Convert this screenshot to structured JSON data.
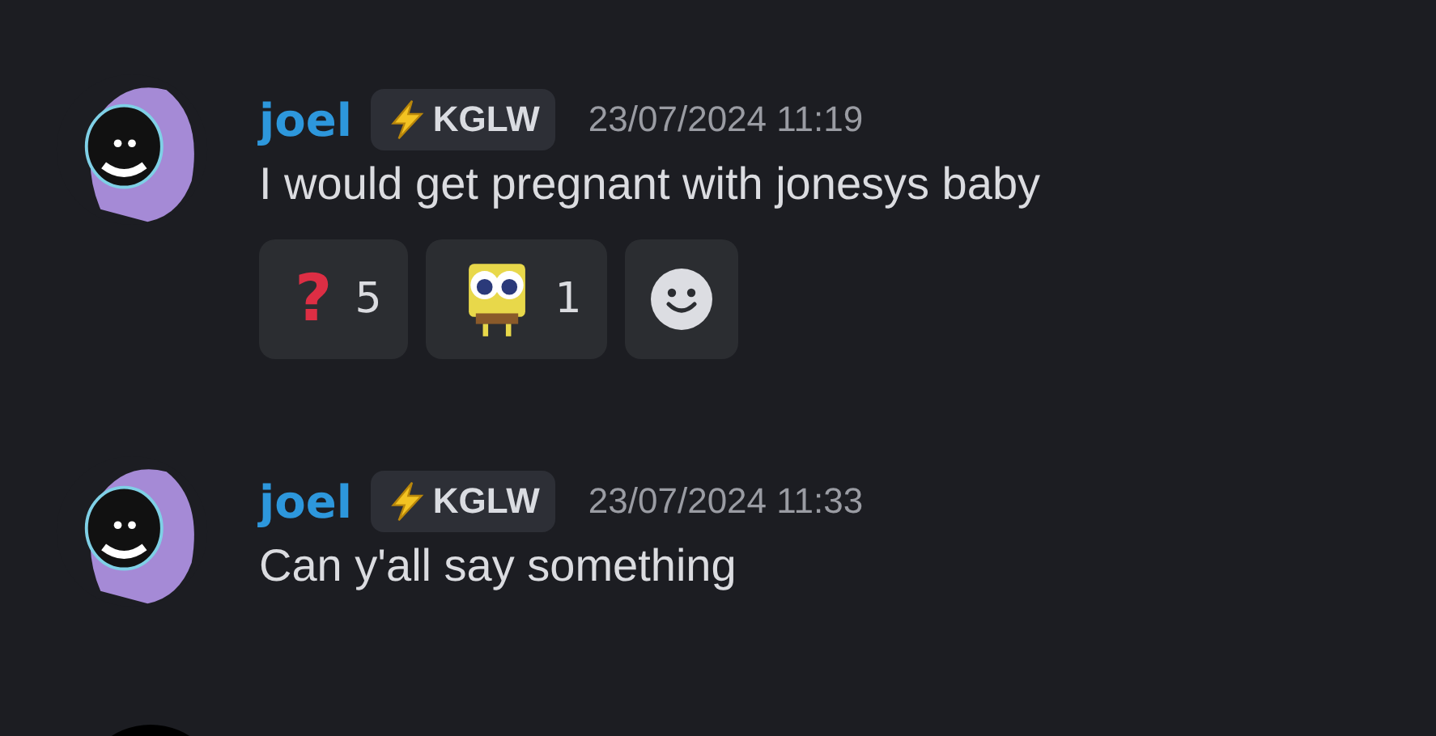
{
  "messages": [
    {
      "author": "joel",
      "role": {
        "label": "KGLW"
      },
      "timestamp": "23/07/2024 11:19",
      "text": "I would get pregnant with jonesys baby",
      "reactions": [
        {
          "kind": "symbol",
          "symbol": "?",
          "count": "5"
        },
        {
          "kind": "sticker",
          "count": "1"
        }
      ],
      "add_reaction_button": true
    },
    {
      "author": "joel",
      "role": {
        "label": "KGLW"
      },
      "timestamp": "23/07/2024 11:33",
      "text": "Can y'all say something"
    }
  ]
}
